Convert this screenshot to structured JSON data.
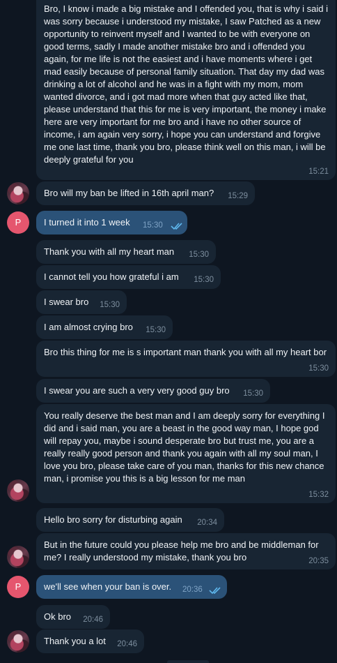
{
  "messages": {
    "m1": {
      "text": "Bro, I know i made a big mistake and I offended you, that is why i said i was sorry because i understood my mistake, I saw Patched as a new opportunity to reinvent myself and I wanted to be with everyone on good terms, sadly I made another mistake bro and i offended you again, for me life is not the easiest and i have moments where i get mad easily because of personal family situation. That day my dad was drinking a lot of alcohol and he was in a fight with my mom, mom wanted divorce, and i got mad more when that guy acted like that, please understand that this for me is very important, the money i make here are very important for me bro and i have no other source of income, i am again very sorry, i hope you can understand and forgive me one last time, thank you bro, please think well on this man, i will be deeply grateful for you",
      "time": "15:21"
    },
    "m2": {
      "text": "Bro will my ban be lifted in 16th april man?",
      "time": "15:29"
    },
    "m3": {
      "text": "I turned it into 1 week",
      "time": "15:30"
    },
    "m4": {
      "text": "Thank you with all my heart man",
      "time": "15:30"
    },
    "m5": {
      "text": "I cannot tell you how grateful i am",
      "time": "15:30"
    },
    "m6": {
      "text": "I swear bro",
      "time": "15:30"
    },
    "m7": {
      "text": "I am almost crying bro",
      "time": "15:30"
    },
    "m8": {
      "text": "Bro this thing for me is s important man thank you with all my heart bor",
      "time": "15:30"
    },
    "m9": {
      "text": "I swear you are such a very very good guy bro",
      "time": "15:30"
    },
    "m10": {
      "text": "You really deserve the best man and I am deeply sorry for everything I did and i said man, you are a beast in the good way man, I hope god will repay you, maybe i sound desperate bro but trust me, you are a really really good person and thank you again with all my soul man, I love you bro, please take care of you man, thanks for this new chance man, i promise you this is a big lesson for me man",
      "time": "15:32"
    },
    "m11": {
      "text": "Hello bro sorry for disturbing again",
      "time": "20:34"
    },
    "m12": {
      "text": "But in the future could you please help me bro and be middleman for me? I really understood my mistake, thank you bro",
      "time": "20:35"
    },
    "m13": {
      "text": "we'll see when your ban is over.",
      "time": "20:36"
    },
    "m14": {
      "text": "Ok bro",
      "time": "20:46"
    },
    "m15": {
      "text": "Thank you a lot",
      "time": "20:46"
    }
  },
  "avatars": {
    "outgoing_letter": "P"
  },
  "colors": {
    "background": "#0e1621",
    "incoming_bubble": "#182533",
    "outgoing_bubble": "#2b5278",
    "outgoing_avatar": "#e5566e",
    "read_ticks": "#5fb8ee"
  },
  "icons": {
    "read_receipt": "double-check-icon"
  }
}
